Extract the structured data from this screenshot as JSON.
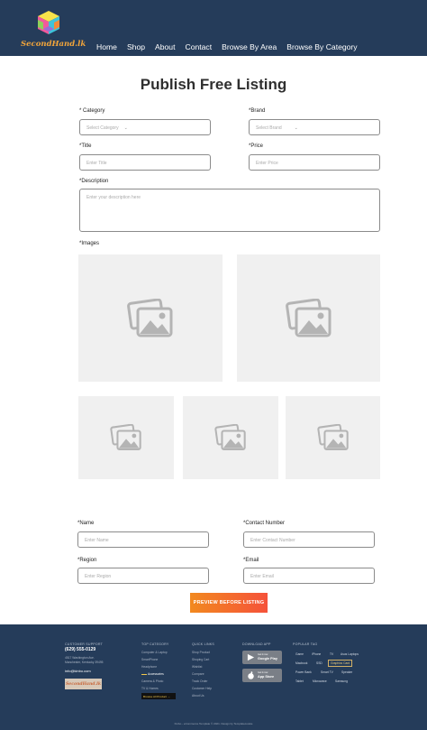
{
  "brand": {
    "logo_text": "SecondHand.lk"
  },
  "nav": [
    "Home",
    "Shop",
    "About",
    "Contact",
    "Browse By Area",
    "Browse By Category"
  ],
  "page_title": "Publish Free Listing",
  "form": {
    "category": {
      "label": "* Category",
      "placeholder": "Select Category"
    },
    "brand": {
      "label": "*Brand",
      "placeholder": "Select Brand"
    },
    "title": {
      "label": "*Title",
      "placeholder": "Enter Title"
    },
    "price": {
      "label": "*Price",
      "placeholder": "Enter Price"
    },
    "description": {
      "label": "*Description",
      "placeholder": "Enter your description here"
    },
    "images_label": "*Images",
    "name": {
      "label": "*Name",
      "placeholder": "Enter Name"
    },
    "contact": {
      "label": "*Contact Number",
      "placeholder": "Enter Contact Number"
    },
    "region": {
      "label": "*Region",
      "placeholder": "Enter Region"
    },
    "email": {
      "label": "*Email",
      "placeholder": "Enter Email"
    },
    "submit_label": "PREVIEW BEFORE LISTING"
  },
  "footer": {
    "contact": {
      "heading": "CUSTOMER SUPPORT",
      "phone": "(629) 555-0129",
      "address_line1": "4517 Washington Ave.",
      "address_line2": "Manchester, Kentucky 39495",
      "email": "info@kinbo.com",
      "logo_text": "SecondHand.lk"
    },
    "top_category": {
      "heading": "TOP CATEGORY",
      "items": [
        "Computer & Laptop",
        "SmartPhone",
        "Headphone",
        "Accessories",
        "Camera & Photo",
        "TV & Homes"
      ],
      "browse_all": "Browse All Product →"
    },
    "quick_links": {
      "heading": "QUICK LINKS",
      "items": [
        "Shop Product",
        "Shoping Cart",
        "Wishlist",
        "Compare",
        "Track Order",
        "Customer Help",
        "About Us"
      ]
    },
    "download": {
      "heading": "DOWNLOAD APP",
      "google_small": "Get it now",
      "google_large": "Google Play",
      "apple_small": "Get it now",
      "apple_large": "App Store"
    },
    "tags": {
      "heading": "POPULAR TAG",
      "items": [
        "Game",
        "iPhone",
        "TV",
        "Asus Laptops",
        "Macbook",
        "SSD",
        "Graphics Card",
        "Power Bank",
        "Smart TV",
        "Speaker",
        "Tablet",
        "Microwave",
        "Samsung"
      ],
      "highlighted": "Graphics Card"
    },
    "copyright": "Kinbo - eCommerce Template © 2021. Design by Templatecookie"
  }
}
